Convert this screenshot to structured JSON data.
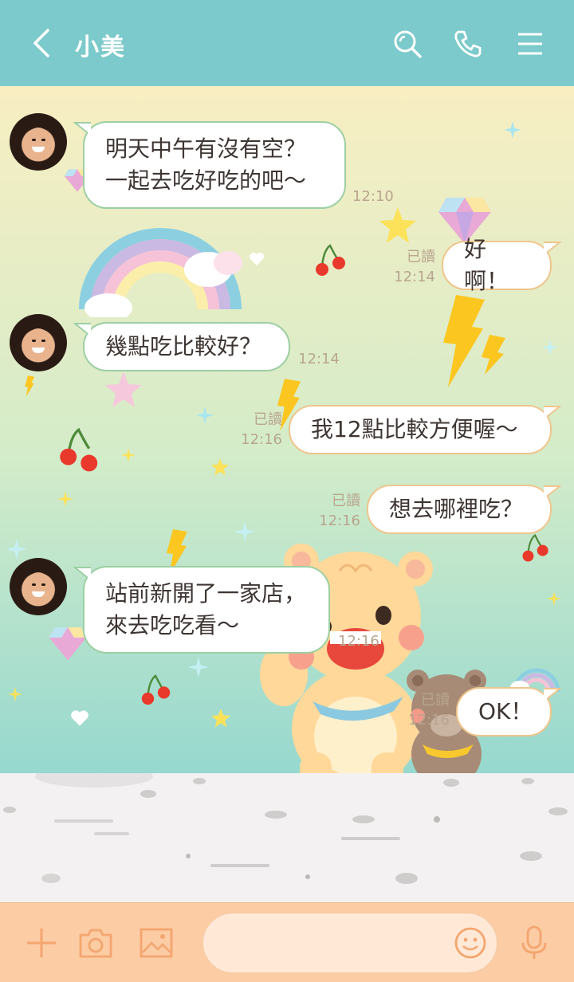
{
  "header": {
    "title": "小美",
    "icons": [
      "back-icon",
      "search-icon",
      "phone-icon",
      "menu-icon"
    ]
  },
  "messages": [
    {
      "side": "left",
      "text": "明天中午有沒有空？\n一起去吃好吃的吧～",
      "time": "12:10"
    },
    {
      "side": "right",
      "text": "好啊！",
      "read": "已讀",
      "time": "12:14"
    },
    {
      "side": "left",
      "text": "幾點吃比較好？",
      "time": "12:14"
    },
    {
      "side": "right",
      "text": "我12點比較方便喔～",
      "read": "已讀",
      "time": "12:16"
    },
    {
      "side": "right",
      "text": "想去哪裡吃？",
      "read": "已讀",
      "time": "12:16"
    },
    {
      "side": "left",
      "text": "站前新開了一家店，\n來去吃吃看～",
      "time": "12:16"
    },
    {
      "side": "right",
      "text": "OK！",
      "read": "已讀",
      "time": "12:16"
    }
  ],
  "footer": {
    "icons": [
      "plus-icon",
      "camera-icon",
      "image-icon",
      "emoji-icon",
      "microphone-icon"
    ],
    "input_value": ""
  },
  "colors": {
    "header": "#7ccacb",
    "footer": "#fccca4",
    "left_bubble_border": "#9ccfa3",
    "right_bubble_border": "#efc58c"
  }
}
